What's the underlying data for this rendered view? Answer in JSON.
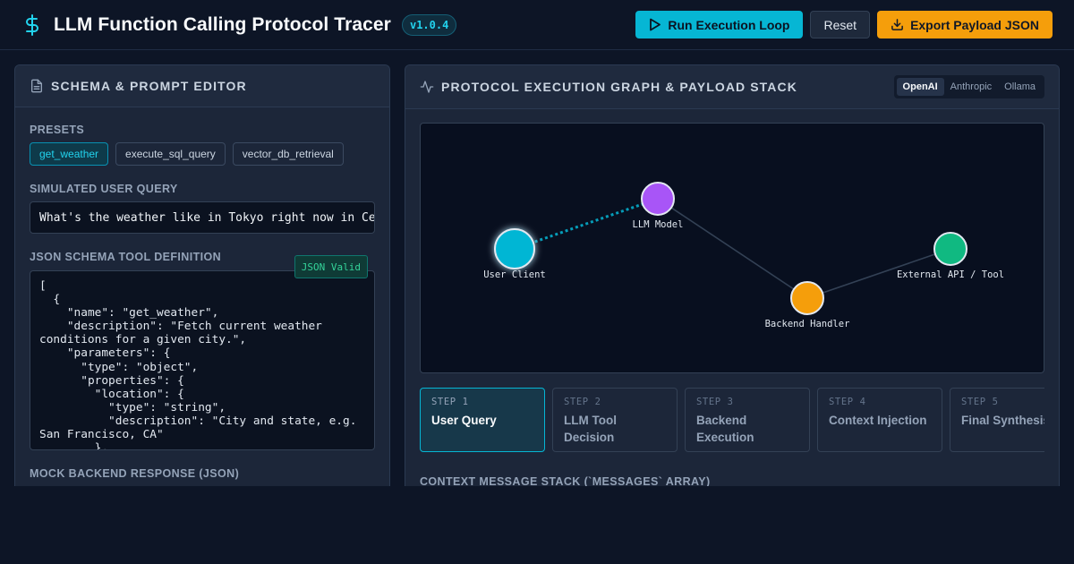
{
  "header": {
    "title": "LLM Function Calling Protocol Tracer",
    "version": "v1.0.4",
    "run_label": "Run Execution Loop",
    "reset_label": "Reset",
    "export_label": "Export Payload JSON"
  },
  "editor": {
    "title": "SCHEMA & PROMPT EDITOR",
    "presets_label": "PRESETS",
    "presets": [
      "get_weather",
      "execute_sql_query",
      "vector_db_retrieval"
    ],
    "active_preset": "get_weather",
    "query_label": "SIMULATED USER QUERY",
    "query_value": "What's the weather like in Tokyo right now in Celsius?",
    "schema_label": "JSON SCHEMA TOOL DEFINITION",
    "schema_badge": "JSON Valid",
    "schema_code": "[\n  {\n    \"name\": \"get_weather\",\n    \"description\": \"Fetch current weather conditions for a given city.\",\n    \"parameters\": {\n      \"type\": \"object\",\n      \"properties\": {\n        \"location\": {\n          \"type\": \"string\",\n          \"description\": \"City and state, e.g. San Francisco, CA\"\n        },",
    "mock_label": "MOCK BACKEND RESPONSE (JSON)"
  },
  "graph_panel": {
    "title": "PROTOCOL EXECUTION GRAPH & PAYLOAD STACK",
    "providers": [
      "OpenAI",
      "Anthropic",
      "Ollama"
    ],
    "active_provider": "OpenAI",
    "nodes": {
      "user": "User Client",
      "llm": "LLM Model",
      "backend": "Backend Handler",
      "api": "External API / Tool"
    },
    "colors": {
      "user": "#06b6d4",
      "llm": "#a855f7",
      "backend": "#f59e0b",
      "api": "#10b981"
    },
    "steps": [
      {
        "num": "STEP 1",
        "title": "User Query"
      },
      {
        "num": "STEP 2",
        "title": "LLM Tool Decision"
      },
      {
        "num": "STEP 3",
        "title": "Backend Execution"
      },
      {
        "num": "STEP 4",
        "title": "Context Injection"
      },
      {
        "num": "STEP 5",
        "title": "Final Synthesis"
      }
    ],
    "context_label": "CONTEXT MESSAGE STACK (`MESSAGES` ARRAY)"
  }
}
